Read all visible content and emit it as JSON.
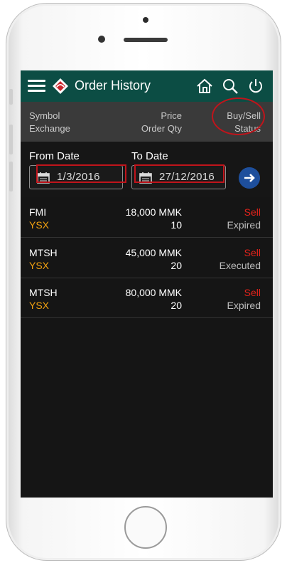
{
  "appbar": {
    "title": "Order History",
    "icons": [
      "menu-icon",
      "home-icon",
      "search-icon",
      "power-icon"
    ],
    "color": "#0c4d44"
  },
  "columns": {
    "symbol": "Symbol",
    "exchange": "Exchange",
    "price": "Price",
    "order_qty": "Order Qty",
    "buy_sell": "Buy/Sell",
    "status": "Status"
  },
  "filter": {
    "from_label": "From Date",
    "from_value": "1/3/2016",
    "to_label": "To Date",
    "to_value": "27/12/2016"
  },
  "orders": [
    {
      "symbol": "FMI",
      "exchange": "YSX",
      "price": "18,000 MMK",
      "qty": "10",
      "side": "Sell",
      "status": "Expired"
    },
    {
      "symbol": "MTSH",
      "exchange": "YSX",
      "price": "45,000 MMK",
      "qty": "20",
      "side": "Sell",
      "status": "Executed"
    },
    {
      "symbol": "MTSH",
      "exchange": "YSX",
      "price": "80,000 MMK",
      "qty": "20",
      "side": "Sell",
      "status": "Expired"
    }
  ],
  "colors": {
    "sell": "#e0231b",
    "exchange": "#f0a010",
    "highlight": "#c0141b",
    "go_button": "#1e4f9c"
  }
}
